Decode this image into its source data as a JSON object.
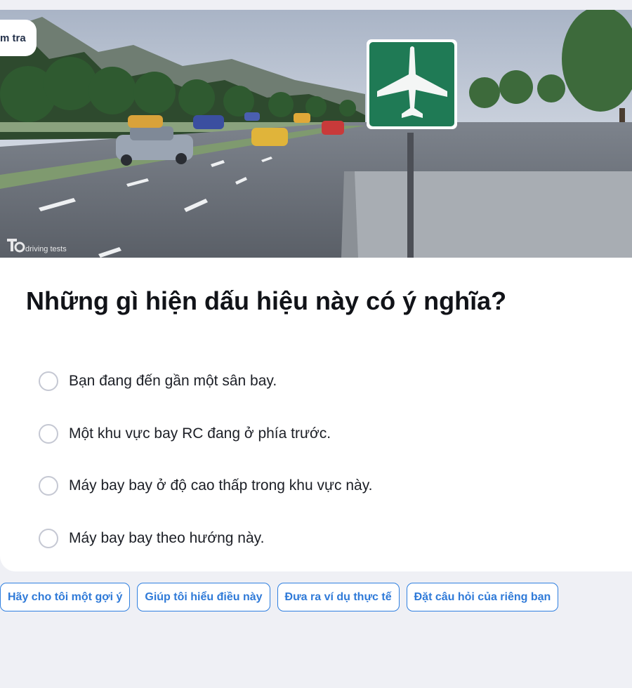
{
  "quiz": {
    "tag_chip": "m tra",
    "watermark": "driving tests",
    "question": "Những gì hiện dấu hiệu này có ý nghĩa?",
    "options": [
      "Bạn đang đến gần một sân bay.",
      "Một khu vực bay RC đang ở phía trước.",
      "Máy bay bay ở độ cao thấp trong khu vực này.",
      "Máy bay bay theo hướng này."
    ]
  },
  "suggestions": [
    "Hãy cho tôi một gợi ý",
    "Giúp tôi hiểu điều này",
    "Đưa ra ví dụ thực tế",
    "Đặt câu hỏi của riêng bạn"
  ],
  "colors": {
    "sign_green": "#1f7a55",
    "accent_blue": "#2f7ad8",
    "page_bg": "#eff0f5"
  },
  "icons": {
    "sign": "airplane-icon",
    "radio": "radio-unchecked-icon"
  }
}
